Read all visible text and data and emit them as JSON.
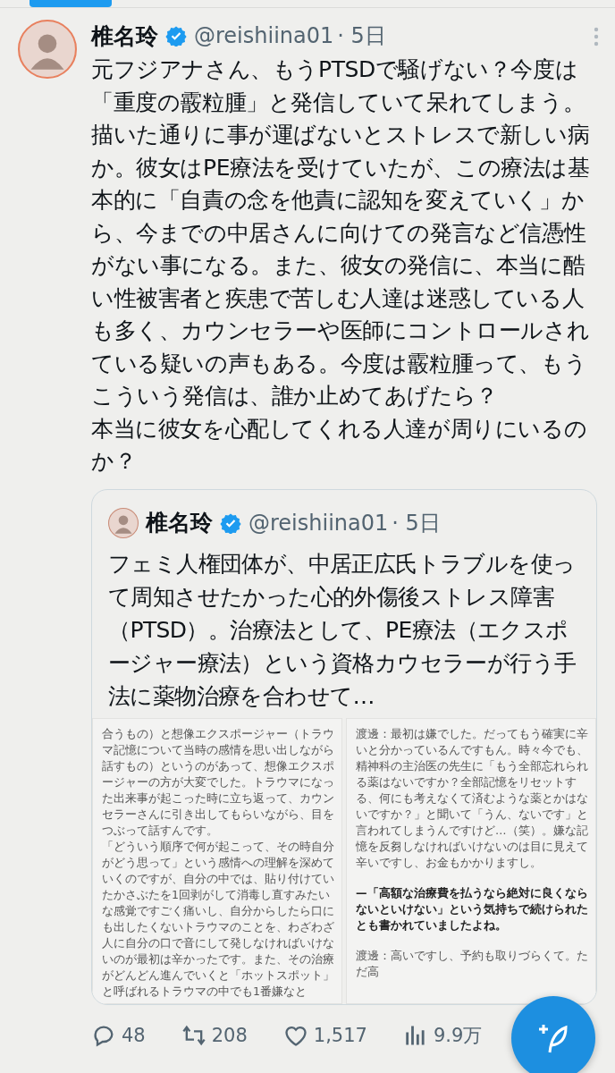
{
  "tweet": {
    "author": {
      "name": "椎名玲",
      "verified": true,
      "handle": "@reishiina01",
      "time": "· 5日"
    },
    "text": [
      "元フジアナさん、もうPTSDで騒げない？今度は「重度の霰粒腫」と発信していて呆れてしまう。描いた通りに事が運ばないとストレスで新しい病か。彼女はPE療法を受けていたが、この療法は基本的に「自責の念を他責に認知を変えていく」から、今までの中居さんに向けての発言など信憑性がない事になる。また、彼女の発信に、本当に酷い性被害者と疾患で苦しむ人達は迷惑している人も多く、カウンセラーや医師にコントロールされている疑いの声もある。今度は霰粒腫って、もうこういう発信は、誰か止めてあげたら？",
      "本当に彼女を心配してくれる人達が周りにいるのか？"
    ],
    "quote": {
      "author": {
        "name": "椎名玲",
        "verified": true,
        "handle": "@reishiina01",
        "time": "· 5日"
      },
      "text": "フェミ人権団体が、中居正広氏トラブルを使って周知させたかった心的外傷後ストレス障害（PTSD）。治療法として、PE療法（エクスポージャー療法）という資格カウセラーが行う手法に薬物治療を合わせて…",
      "images": [
        {
          "paragraphs": [
            {
              "text": "合うもの）と想像エクスポージャー（トラウマ記憶について当時の感情を思い出しながら話すもの）というのがあって、想像エクスポージャーの方が大変でした。トラウマになった出来事が起こった時に立ち返って、カウンセラーさんに引き出してもらいながら、目をつぶって話すんです。",
              "bold": false
            },
            {
              "text": "「どういう順序で何が起こって、その時自分がどう思って」という感情への理解を深めていくのですが、自分の中では、貼り付けていたかさぶたを1回剥がして消毒し直すみたいな感覚ですごく痛いし、自分からしたら口にも出したくないトラウマのことを、わざわざ人に自分の口で音にして発しなければいけないのが最初は辛かったです。また、その治療がどんどん進んでいくと「ホットスポット」と呼ばれるトラウマの中でも1番嫌なと",
              "bold": false
            }
          ]
        },
        {
          "paragraphs": [
            {
              "text": "渡邊：最初は嫌でした。だってもう確実に辛いと分かっているんですもん。時々今でも、精神科の主治医の先生に「もう全部忘れられる薬はないですか？全部記憶をリセットする、何にも考えなくて済むような薬とかはないですか？」と聞いて「うん、ないです」と言われてしまうんですけど…（笑）。嫌な記憶を反芻しなければいけないのは目に見えて辛いですし、お金もかかりますし。",
              "bold": false
            },
            {
              "text": "—「高額な治療費を払うなら絶対に良くならないといけない」という気持ちで続けられたとも書かれていましたよね。",
              "bold": true
            },
            {
              "text": "渡邊：高いですし、予約も取りづらくて。ただ高",
              "bold": false
            }
          ]
        }
      ]
    },
    "actions": [
      {
        "kind": "reply",
        "count": "48"
      },
      {
        "kind": "repost",
        "count": "208"
      },
      {
        "kind": "like",
        "count": "1,517"
      },
      {
        "kind": "views",
        "count": "9.9万"
      }
    ]
  }
}
